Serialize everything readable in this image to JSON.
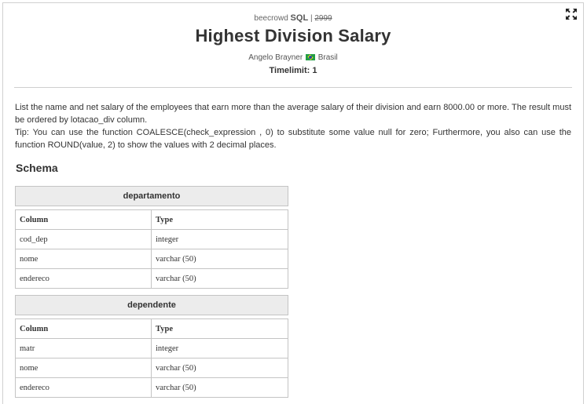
{
  "meta": {
    "site": "beecrowd",
    "category": "SQL",
    "separator": "|",
    "problem_number": "2999"
  },
  "title": "Highest Division Salary",
  "author": {
    "name": "Angelo Brayner",
    "country": "Brasil"
  },
  "timelimit": "Timelimit: 1",
  "description": [
    "List the name and net salary of the employees that earn more than the average salary of their division and earn 8000.00 or more. The result must be ordered by lotacao_div column.",
    "Tip: You can use the function COALESCE(check_expression , 0) to substitute some value null for zero; Furthermore, you also can use the function ROUND(value, 2) to show the values with 2 decimal places."
  ],
  "schema_heading": "Schema",
  "tables": [
    {
      "name": "departamento",
      "headers": [
        "Column",
        "Type"
      ],
      "rows": [
        [
          "cod_dep",
          "integer"
        ],
        [
          "nome",
          "varchar (50)"
        ],
        [
          "endereco",
          "varchar (50)"
        ]
      ]
    },
    {
      "name": "dependente",
      "headers": [
        "Column",
        "Type"
      ],
      "rows": [
        [
          "matr",
          "integer"
        ],
        [
          "nome",
          "varchar (50)"
        ],
        [
          "endereco",
          "varchar (50)"
        ]
      ]
    }
  ],
  "icons": {
    "expand": "expand-icon",
    "flag": "brazil-flag-icon"
  }
}
